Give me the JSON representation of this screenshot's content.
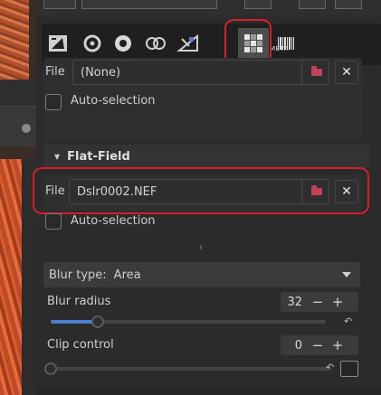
{
  "tabs": [
    {
      "icon": "image-exposure-icon"
    },
    {
      "icon": "details-icon"
    },
    {
      "icon": "color-icon"
    },
    {
      "icon": "advanced-icon"
    },
    {
      "icon": "transform-icon"
    },
    {
      "icon": "raw-icon"
    },
    {
      "icon": "metadata-icon",
      "label": "META"
    }
  ],
  "dark_frame": {
    "file_label": "File",
    "file_value": "(None)",
    "auto_selection_label": "Auto-selection"
  },
  "flat_field": {
    "title": "Flat-Field",
    "file_label": "File",
    "file_value": "Dslr0002.NEF",
    "auto_selection_label": "Auto-selection",
    "blur_type_label": "Blur type:",
    "blur_type_value": "Area",
    "blur_radius_label": "Blur radius",
    "blur_radius_value": "32",
    "blur_radius_fraction": 0.17,
    "clip_control_label": "Clip control",
    "clip_control_value": "0",
    "clip_control_fraction": 0.0
  },
  "colors": {
    "highlight": "#d21f2a",
    "accent": "#4a7fd0",
    "open_file_icon": "#c0435c"
  }
}
